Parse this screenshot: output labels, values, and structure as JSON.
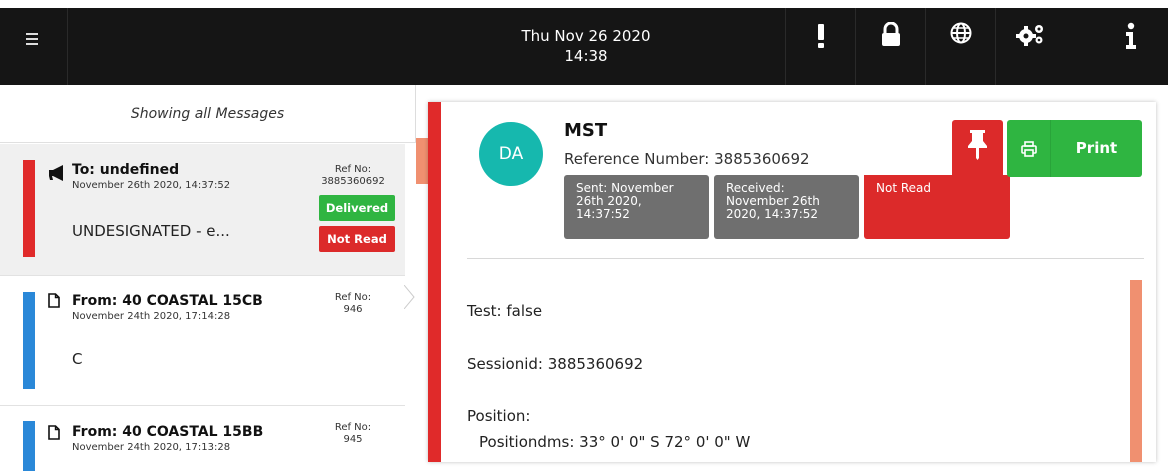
{
  "header": {
    "date": "Thu Nov 26 2020",
    "time": "14:38",
    "icons": [
      "menu-icon",
      "alert-icon",
      "lock-icon",
      "globe-icon",
      "settings-icon",
      "info-icon"
    ]
  },
  "list": {
    "heading": "Showing all Messages",
    "messages": [
      {
        "who": "To: undefined",
        "when": "November 26th 2020, 14:37:52",
        "preview": "UNDESIGNATED - e...",
        "ref_label": "Ref No:",
        "ref": "3885360692",
        "badges": [
          "Delivered",
          "Not Read"
        ],
        "color": "#e02a2a",
        "icon": "megaphone-icon"
      },
      {
        "who": "From: 40 COASTAL 15CB",
        "when": "November 24th 2020, 17:14:28",
        "preview": "C",
        "ref_label": "Ref No:",
        "ref": "946",
        "color": "#2a88d8",
        "icon": "document-icon"
      },
      {
        "who": "From: 40 COASTAL 15BB",
        "when": "November 24th 2020, 17:13:28",
        "preview": "",
        "ref_label": "Ref No:",
        "ref": "945",
        "color": "#2a88d8",
        "icon": "document-icon"
      }
    ]
  },
  "detail": {
    "avatar": "DA",
    "title": "MST",
    "reference": "Reference Number: 3885360692",
    "chips": {
      "sent": "Sent: November 26th 2020, 14:37:52",
      "received": "Received: November 26th 2020, 14:37:52",
      "status": "Not Read"
    },
    "print_label": "Print",
    "body": {
      "test": "Test: false",
      "sessionid": "Sessionid: 3885360692",
      "position": "Position:",
      "positiondms": "Positiondms: 33° 0' 0\" S 72° 0' 0\" W"
    }
  },
  "colors": {
    "accent_red": "#dc2a2a",
    "green": "#2fb541",
    "teal": "#16b8ae",
    "blue": "#2a88d8",
    "orange": "#f09070"
  }
}
